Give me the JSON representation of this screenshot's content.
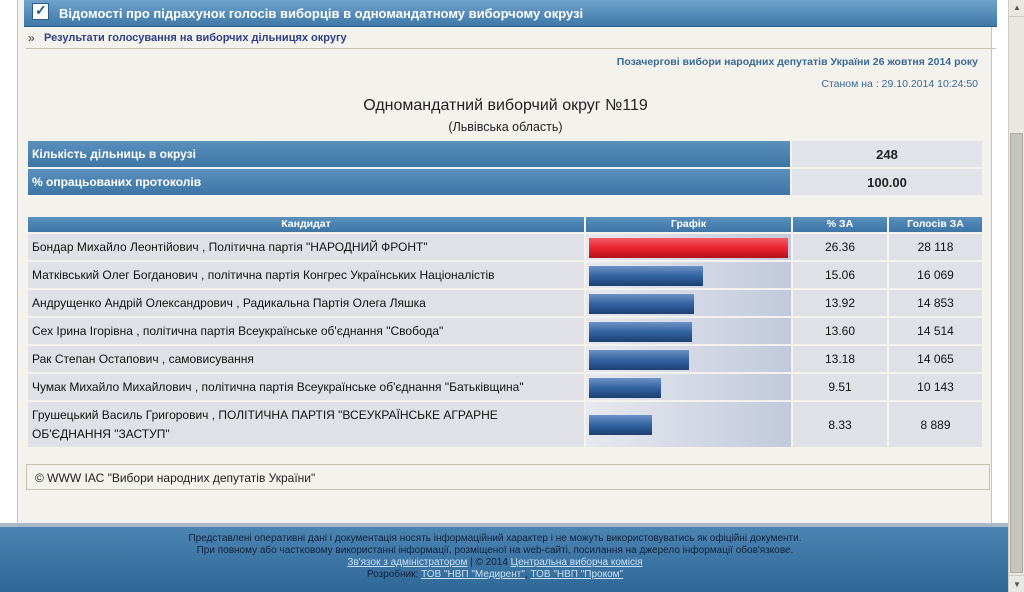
{
  "header": {
    "check_icon": "checkbox-checked-icon",
    "title": "Відомості про підрахунок голосів виборців в одномандатному виборчому окрузі"
  },
  "subnav": {
    "arrow": "»",
    "link": "Результати голосування на виборчих дільницях округу"
  },
  "election_title": "Позачергові вибори народних депутатів України 26 жовтня 2014 року",
  "status_time": "Станом на : 29.10.2014 10:24:50",
  "district": {
    "title": "Одномандатний виборчий округ №119",
    "region": "(Львівська область)"
  },
  "summary": [
    {
      "label": "Кількість дільниць в окрузі",
      "value": "248"
    },
    {
      "label": "% опрацьованих протоколів",
      "value": "100.00"
    }
  ],
  "results": {
    "columns": [
      "Кандидат",
      "Графік",
      "% ЗА",
      "Голосів ЗА"
    ],
    "max_percent": 26.36,
    "colors": {
      "leader": "#e8202e",
      "other": "#2f5f9e"
    },
    "rows": [
      {
        "candidate": "Бондар Михайло Леонтійович , Політична партія \"НАРОДНИЙ ФРОНТ\"",
        "percent": "26.36",
        "votes": "28 118",
        "value": 26.36
      },
      {
        "candidate": "Матківський Олег Богданович , політична партія Конгрес Українських Націоналістів",
        "percent": "15.06",
        "votes": "16 069",
        "value": 15.06
      },
      {
        "candidate": "Андрущенко Андрій Олександрович , Радикальна Партія Олега Ляшка",
        "percent": "13.92",
        "votes": "14 853",
        "value": 13.92
      },
      {
        "candidate": "Сех Ірина Ігорівна , політична партія Всеукраїнське об'єднання \"Свобода\"",
        "percent": "13.60",
        "votes": "14 514",
        "value": 13.6
      },
      {
        "candidate": "Рак Степан Остапович , самовисування",
        "percent": "13.18",
        "votes": "14 065",
        "value": 13.18
      },
      {
        "candidate": "Чумак Михайло Михайлович , політична партія Всеукраїнське об'єднання \"Батьківщина\"",
        "percent": "9.51",
        "votes": "10 143",
        "value": 9.51
      },
      {
        "candidate": "Грушецький Василь Григорович , ПОЛІТИЧНА ПАРТІЯ \"ВСЕУКРАЇНСЬКЕ АГРАРНЕ ОБ'ЄДНАННЯ \"ЗАСТУП\"",
        "percent": "8.33",
        "votes": "8 889",
        "value": 8.33
      }
    ]
  },
  "footer_box": "© WWW ІАС \"Вибори народних депутатів України\"",
  "bottom": {
    "line1": "Представлені оперативні дані і документація носять інформаційний характер і не можуть використовуватись як офіційні документи.",
    "line2": "При повному або частковому використанні інформації, розміщеної на web-сайті, посилання на джерело інформації обов'язкове.",
    "contact_link": "Зв'язок з адміністратором",
    "copyright_text": " | © 2014 ",
    "cec_link": "Центральна виборча комісія",
    "developer_label": "Розробник: ",
    "dev_link1": "ТОВ \"НВП \"Медирент\"",
    "dev_separator": ", ",
    "dev_link2": "ТОВ \"НВП \"Проком\""
  },
  "scrollbar": {
    "up_icon": "▲",
    "down_icon": "▼"
  }
}
